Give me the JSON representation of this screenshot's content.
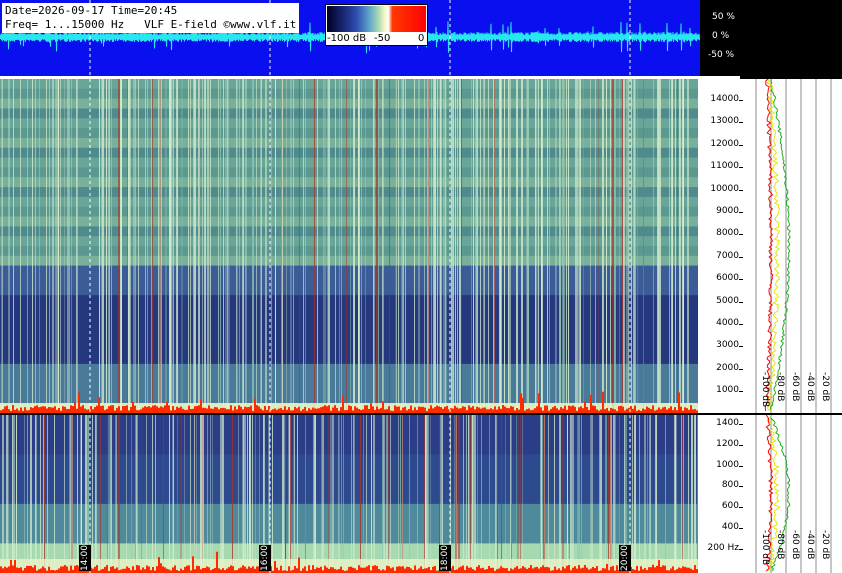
{
  "header": {
    "line1": "Date=2026-09-17 Time=20:45",
    "line2": "Freq= 1...15000 Hz   VLF E-field ©www.vlf.it"
  },
  "colorbar": {
    "labels": [
      "-100 dB",
      "-50",
      "0"
    ]
  },
  "waveform_scale": [
    "50 %",
    "0 %",
    "-50 %"
  ],
  "freq_axis_high": [
    "14000",
    "13000",
    "12000",
    "11000",
    "10000",
    "9000",
    "8000",
    "7000",
    "6000",
    "5000",
    "4000",
    "3000",
    "2000",
    "1000"
  ],
  "freq_axis_low": [
    "1400",
    "1200",
    "1000",
    "800",
    "600",
    "400",
    "200 Hz"
  ],
  "profile_db_labels": [
    "-100 dB",
    "-80 dB",
    "-60 dB",
    "-40 dB",
    "-20 dB"
  ],
  "time_labels": [
    "14:00",
    "16:00",
    "18:00",
    "20:00"
  ],
  "colors": {
    "waveform_bg": "#0a0ff0",
    "waveform_trace": "#27e6f0",
    "profile_red": "#ff0000",
    "profile_yellow": "#e6e600",
    "profile_green": "#22aa22"
  }
}
